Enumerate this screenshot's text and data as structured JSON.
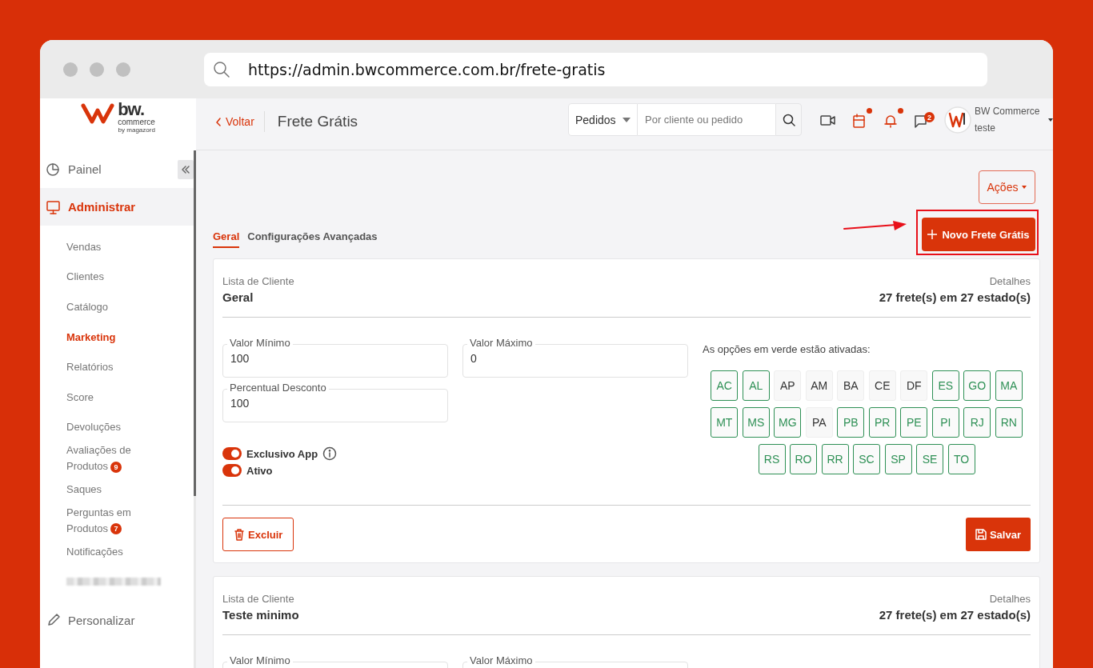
{
  "browser": {
    "url": "https://admin.bwcommerce.com.br/frete-gratis"
  },
  "logo": {
    "name": "bw.",
    "sub": "commerce",
    "by": "by magazord"
  },
  "sidebar": {
    "items": [
      {
        "label": "Painel",
        "selected": false
      },
      {
        "label": "Administrar",
        "selected": true,
        "children": [
          {
            "kind": "link",
            "label": "Vendas",
            "selected": false
          },
          {
            "kind": "link",
            "label": "Clientes",
            "selected": false
          },
          {
            "kind": "link",
            "label": "Catálogo",
            "selected": false
          },
          {
            "kind": "link",
            "label": "Marketing",
            "selected": true
          },
          {
            "kind": "link",
            "label": "Relatórios",
            "selected": false
          },
          {
            "kind": "link",
            "label": "Score",
            "selected": false
          },
          {
            "kind": "link",
            "label": "Devoluções",
            "selected": false
          },
          {
            "kind": "link",
            "label": "Avaliações de Produtos",
            "badge": "9",
            "selected": false
          },
          {
            "kind": "link",
            "label": "Saques",
            "selected": false
          },
          {
            "kind": "link",
            "label": "Perguntas em Produtos",
            "badge": "7",
            "selected": false
          },
          {
            "kind": "link",
            "label": "Notificações",
            "selected": false
          },
          {
            "kind": "blurred"
          }
        ]
      },
      {
        "label": "Personalizar",
        "selected": false
      }
    ]
  },
  "header": {
    "back": "Voltar",
    "title": "Frete Grátis",
    "search": {
      "scope": "Pedidos",
      "placeholder": "Por cliente ou pedido"
    },
    "icons": [
      {
        "kind": "video",
        "alert": false
      },
      {
        "kind": "calendar",
        "alert": true
      },
      {
        "kind": "bell",
        "alert": true
      },
      {
        "kind": "chat",
        "alert": false,
        "count": "2"
      }
    ],
    "user": {
      "name": "BW Commerce",
      "store": "teste"
    }
  },
  "actions_button": "Ações",
  "tabs": [
    {
      "label": "Geral",
      "selected": true
    },
    {
      "label": "Configurações Avançadas",
      "selected": false
    }
  ],
  "new_button": {
    "label": "Novo Frete Grátis",
    "highlighted": true
  },
  "cards": [
    {
      "list_label": "Lista de Cliente",
      "name": "Geral",
      "details_label": "Detalhes",
      "summary": "27 frete(s) em 27 estado(s)",
      "fields": [
        {
          "label": "Valor Mínimo",
          "value": "100"
        },
        {
          "label": "Valor Máximo",
          "value": "0"
        },
        {
          "label": "Percentual Desconto",
          "value": "100"
        }
      ],
      "toggles": [
        {
          "label": "Exclusivo App",
          "on": true,
          "info": true
        },
        {
          "label": "Ativo",
          "on": true,
          "info": false
        }
      ],
      "states_hint": "As opções em verde estão ativadas:",
      "states": [
        {
          "code": "AC",
          "active": true
        },
        {
          "code": "AL",
          "active": true
        },
        {
          "code": "AP",
          "active": false
        },
        {
          "code": "AM",
          "active": false
        },
        {
          "code": "BA",
          "active": false
        },
        {
          "code": "CE",
          "active": false
        },
        {
          "code": "DF",
          "active": false
        },
        {
          "code": "ES",
          "active": true
        },
        {
          "code": "GO",
          "active": true
        },
        {
          "code": "MA",
          "active": true
        },
        {
          "code": "MT",
          "active": true
        },
        {
          "code": "MS",
          "active": true
        },
        {
          "code": "MG",
          "active": true
        },
        {
          "code": "PA",
          "active": false
        },
        {
          "code": "PB",
          "active": true
        },
        {
          "code": "PR",
          "active": true
        },
        {
          "code": "PE",
          "active": true
        },
        {
          "code": "PI",
          "active": true
        },
        {
          "code": "RJ",
          "active": true
        },
        {
          "code": "RN",
          "active": true
        },
        {
          "code": "RS",
          "active": true
        },
        {
          "code": "RO",
          "active": true
        },
        {
          "code": "RR",
          "active": true
        },
        {
          "code": "SC",
          "active": true
        },
        {
          "code": "SP",
          "active": true
        },
        {
          "code": "SE",
          "active": true
        },
        {
          "code": "TO",
          "active": true
        }
      ],
      "delete_button": "Excluir",
      "save_button": "Salvar"
    },
    {
      "list_label": "Lista de Cliente",
      "name": "Teste minimo",
      "details_label": "Detalhes",
      "summary": "27 frete(s) em 27 estado(s)",
      "fields": [
        {
          "label": "Valor Mínimo"
        },
        {
          "label": "Valor Máximo"
        }
      ]
    }
  ]
}
